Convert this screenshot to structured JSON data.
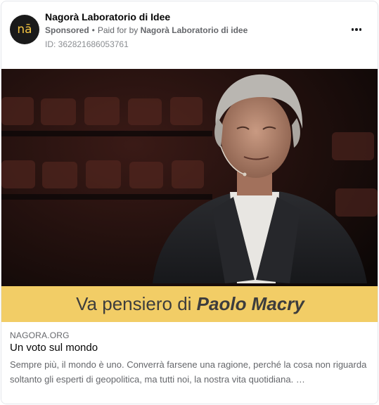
{
  "ad": {
    "advertiser_name": "Nagorà Laboratorio di Idee",
    "avatar_text": "nā",
    "sponsored_label": "Sponsored",
    "paid_for_prefix": "Paid for by",
    "paid_for_name": "Nagorà Laboratorio di idee",
    "id_text": "ID: 362821686053761",
    "more_label": "More options"
  },
  "image": {
    "banner_prefix": "Va pensiero di",
    "banner_name": "Paolo Macry",
    "brand_color": "#f2cd66"
  },
  "link": {
    "domain": "NAGORA.ORG",
    "headline": "Un voto sul mondo",
    "description": "Sempre più, il mondo è uno. Converrà farsene una ragione, perché la cosa non riguarda soltanto gli esperti di geopolitica, ma tutti noi, la nostra vita quotidiana. …"
  }
}
